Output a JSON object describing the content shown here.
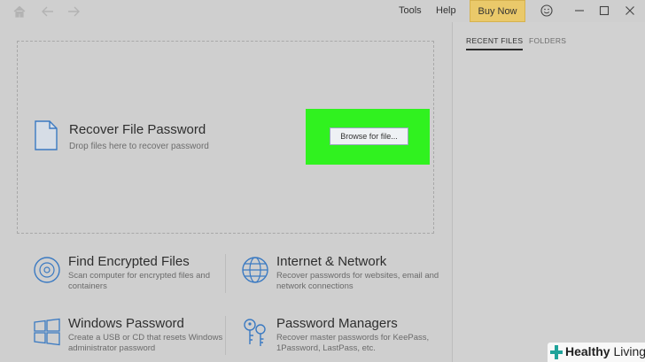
{
  "titlebar": {
    "menu": {
      "tools": "Tools",
      "help": "Help"
    },
    "buy_now": "Buy Now"
  },
  "drop_zone": {
    "title": "Recover File Password",
    "subtitle": "Drop files here to recover password",
    "browse_label": "Browse for file..."
  },
  "cards": [
    {
      "title": "Find Encrypted Files",
      "desc": "Scan computer for encrypted files and containers",
      "icon": "disc-icon"
    },
    {
      "title": "Internet & Network",
      "desc": "Recover passwords for websites, email and network connections",
      "icon": "globe-icon"
    },
    {
      "title": "Windows Password",
      "desc": "Create a USB or CD that resets Windows administrator password",
      "icon": "windows-logo-icon"
    },
    {
      "title": "Password Managers",
      "desc": "Recover master passwords for KeePass, 1Password, LastPass, etc.",
      "icon": "keys-icon"
    }
  ],
  "side": {
    "tabs": [
      {
        "label": "RECENT FILES",
        "active": true
      },
      {
        "label": "FOLDERS",
        "active": false
      }
    ]
  },
  "watermark": {
    "brand_bold": "Healthy",
    "brand_light": "Living"
  },
  "colors": {
    "highlight": "#30f21f",
    "buy_button": "#eac96a",
    "icon_blue": "#3b7ac2"
  }
}
